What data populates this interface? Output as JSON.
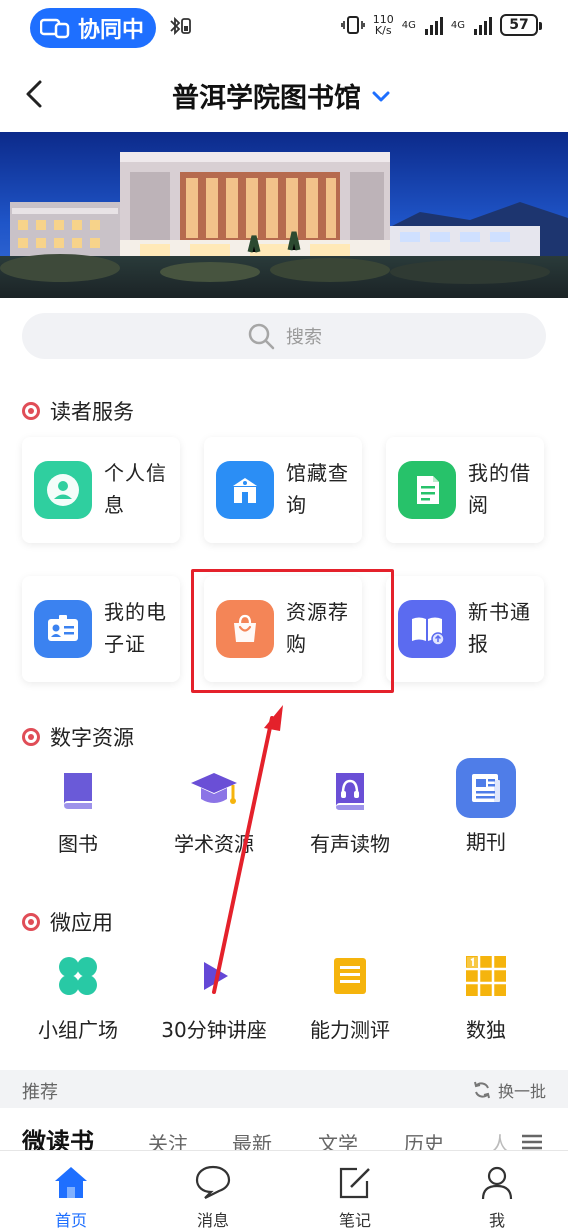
{
  "status_bar": {
    "collab_label": "协同中",
    "speed_value": "110",
    "speed_unit": "K/s",
    "net1": "4G",
    "net2": "4G",
    "battery": "57"
  },
  "header": {
    "title": "普洱学院图书馆"
  },
  "search": {
    "placeholder": "搜索"
  },
  "reader_services": {
    "title": "读者服务",
    "items": [
      {
        "label": "个人信息",
        "icon": "person-icon",
        "color": "#2fcf9f"
      },
      {
        "label": "馆藏查询",
        "icon": "library-building-icon",
        "color": "#2b8ef5"
      },
      {
        "label": "我的借阅",
        "icon": "document-icon",
        "color": "#27c26a"
      },
      {
        "label": "我的电子证",
        "icon": "id-card-icon",
        "color": "#3b82f0"
      },
      {
        "label": "资源荐购",
        "icon": "shopping-bag-icon",
        "color": "#f48557"
      },
      {
        "label": "新书通报",
        "icon": "open-book-icon",
        "color": "#5b6bf0"
      }
    ]
  },
  "digital_resources": {
    "title": "数字资源",
    "items": [
      {
        "label": "图书",
        "icon": "book-icon",
        "color": "#6a5ad8"
      },
      {
        "label": "学术资源",
        "icon": "graduation-cap-icon",
        "color": "#6a4fd6"
      },
      {
        "label": "有声读物",
        "icon": "audiobook-icon",
        "color": "#6a4fd6"
      },
      {
        "label": "期刊",
        "icon": "journal-icon",
        "color": "#4f7de8"
      }
    ]
  },
  "micro_apps": {
    "title": "微应用",
    "items": [
      {
        "label": "小组广场",
        "icon": "group-clover-icon",
        "color": "#28c9a5"
      },
      {
        "label": "30分钟讲座",
        "icon": "play-triangle-icon",
        "color": "#6447d6"
      },
      {
        "label": "能力测评",
        "icon": "test-sheet-icon",
        "color": "#f5b40d"
      },
      {
        "label": "数独",
        "icon": "sudoku-icon",
        "color": "#f5b40d"
      }
    ]
  },
  "recommend": {
    "title": "推荐",
    "refresh_label": "换一批",
    "tabs": [
      "微读书",
      "关注",
      "最新",
      "文学",
      "历史",
      "人"
    ]
  },
  "bottom_nav": {
    "items": [
      {
        "label": "首页",
        "icon": "home-icon",
        "active": true
      },
      {
        "label": "消息",
        "icon": "chat-bubble-icon",
        "active": false
      },
      {
        "label": "笔记",
        "icon": "note-edit-icon",
        "active": false
      },
      {
        "label": "我",
        "icon": "user-icon",
        "active": false
      }
    ]
  },
  "colors": {
    "accent": "#1e6fff",
    "highlight": "#e4212b",
    "section_dot": "#e04d57"
  }
}
